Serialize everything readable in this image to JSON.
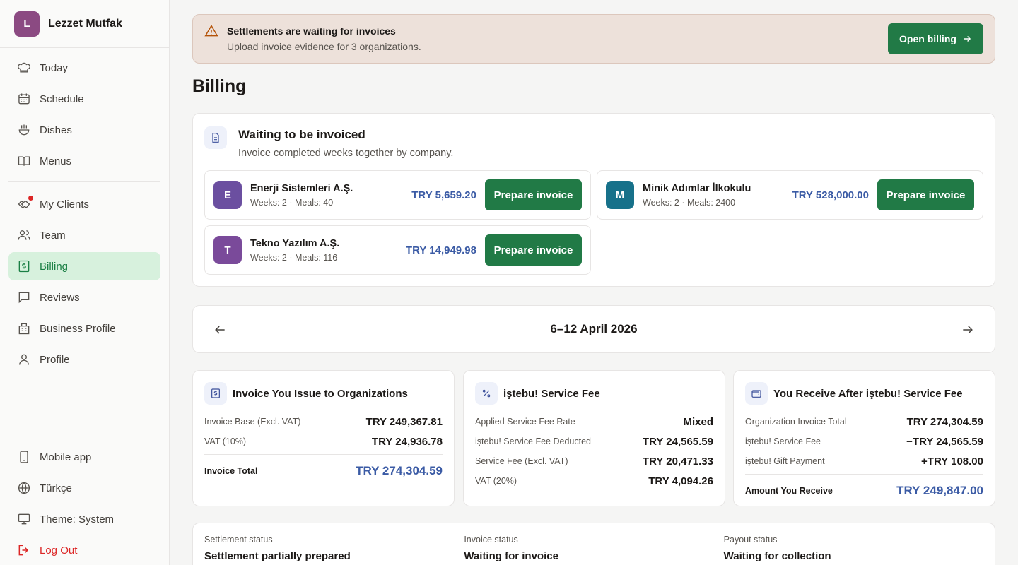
{
  "brand": {
    "initial": "L",
    "name": "Lezzet Mutfak",
    "color": "#8b4a82"
  },
  "nav": {
    "group1": [
      {
        "label": "Today",
        "icon": "chef-hat-icon"
      },
      {
        "label": "Schedule",
        "icon": "calendar-icon"
      },
      {
        "label": "Dishes",
        "icon": "bowl-icon"
      },
      {
        "label": "Menus",
        "icon": "book-icon"
      }
    ],
    "group2": [
      {
        "label": "My Clients",
        "icon": "handshake-icon",
        "notification": true
      },
      {
        "label": "Team",
        "icon": "users-icon"
      },
      {
        "label": "Billing",
        "icon": "receipt-icon",
        "active": true
      },
      {
        "label": "Reviews",
        "icon": "message-icon"
      },
      {
        "label": "Business Profile",
        "icon": "building-icon"
      },
      {
        "label": "Profile",
        "icon": "user-icon"
      }
    ],
    "bottom": [
      {
        "label": "Mobile app",
        "icon": "smartphone-icon"
      },
      {
        "label": "Türkçe",
        "icon": "globe-icon"
      },
      {
        "label": "Theme: System",
        "icon": "monitor-icon"
      },
      {
        "label": "Log Out",
        "icon": "logout-icon"
      }
    ]
  },
  "alert": {
    "title": "Settlements are waiting for invoices",
    "subtitle": "Upload invoice evidence for 3 organizations.",
    "button": "Open billing"
  },
  "page_title": "Billing",
  "waiting": {
    "title": "Waiting to be invoiced",
    "subtitle": "Invoice completed weeks together by company.",
    "orgs": [
      {
        "initial": "E",
        "name": "Enerji Sistemleri A.Ş.",
        "meta": "Weeks: 2 · Meals: 40",
        "amount": "TRY 5,659.20",
        "button": "Prepare invoice",
        "color": "#6b4fa0"
      },
      {
        "initial": "M",
        "name": "Minik Adımlar İlkokulu",
        "meta": "Weeks: 2 · Meals: 2400",
        "amount": "TRY 528,000.00",
        "button": "Prepare invoice",
        "color": "#17718a"
      },
      {
        "initial": "T",
        "name": "Tekno Yazılım A.Ş.",
        "meta": "Weeks: 2 · Meals: 116",
        "amount": "TRY 14,949.98",
        "button": "Prepare invoice",
        "color": "#7a4a9a"
      }
    ]
  },
  "week": {
    "label": "6–12 April 2026"
  },
  "summaries": [
    {
      "title": "Invoice You Issue to Organizations",
      "icon": "receipt-icon",
      "rows": [
        {
          "label": "Invoice Base (Excl. VAT)",
          "value": "TRY 249,367.81"
        },
        {
          "label": "VAT (10%)",
          "value": "TRY 24,936.78"
        }
      ],
      "total": {
        "label": "Invoice Total",
        "value": "TRY 274,304.59"
      }
    },
    {
      "title": "iştebu! Service Fee",
      "icon": "percent-icon",
      "rows": [
        {
          "label": "Applied Service Fee Rate",
          "value": "Mixed"
        },
        {
          "label": "iştebu! Service Fee Deducted",
          "value": "TRY 24,565.59"
        },
        {
          "label": "Service Fee (Excl. VAT)",
          "value": "TRY 20,471.33"
        },
        {
          "label": "VAT (20%)",
          "value": "TRY 4,094.26"
        }
      ]
    },
    {
      "title": "You Receive After iştebu! Service Fee",
      "icon": "wallet-icon",
      "rows": [
        {
          "label": "Organization Invoice Total",
          "value": "TRY 274,304.59"
        },
        {
          "label": "iştebu! Service Fee",
          "value": "−TRY 24,565.59"
        },
        {
          "label": "iştebu! Gift Payment",
          "value": "+TRY 108.00"
        }
      ],
      "total": {
        "label": "Amount You Receive",
        "value": "TRY 249,847.00"
      }
    }
  ],
  "status": [
    {
      "label": "Settlement status",
      "value": "Settlement partially prepared"
    },
    {
      "label": "Invoice status",
      "value": "Waiting for invoice"
    },
    {
      "label": "Payout status",
      "value": "Waiting for collection"
    }
  ],
  "colors": {
    "accent": "#217a46",
    "active_bg": "#d7f1dd",
    "amount": "#3b5ba5",
    "alert_bg": "#ede1da"
  }
}
